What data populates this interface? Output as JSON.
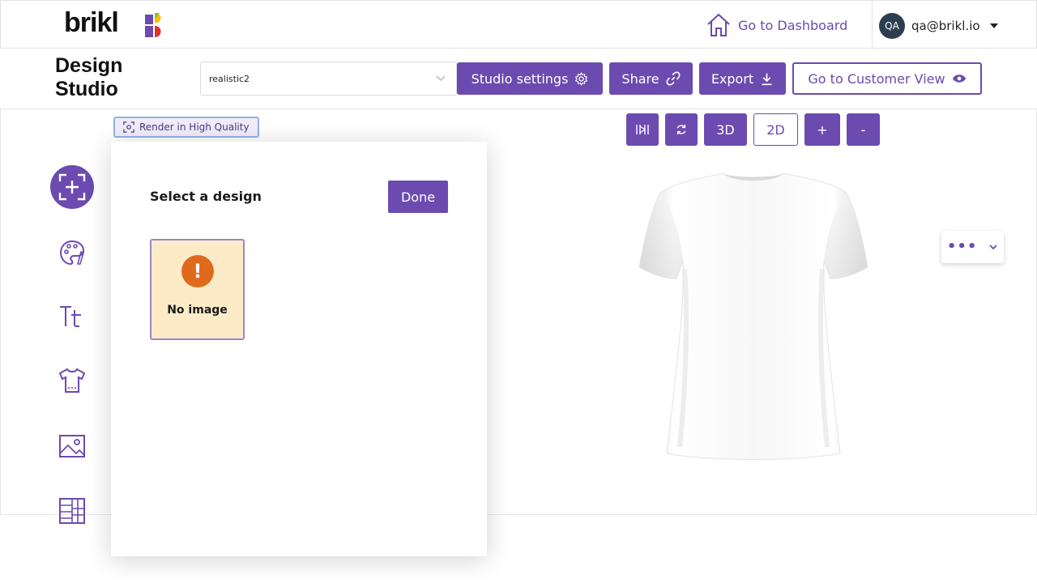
{
  "header": {
    "logo_text": "brikl",
    "dashboard_label": "Go to Dashboard",
    "user_initials": "QA",
    "user_email": "qa@brikl.io"
  },
  "toolbar": {
    "title": "Design Studio",
    "product_select_value": "realistic2",
    "studio_settings_label": "Studio settings",
    "share_label": "Share",
    "export_label": "Export",
    "customer_view_label": "Go to Customer View"
  },
  "render": {
    "hq_label": "Render in High Quality"
  },
  "sidebar": {
    "items": [
      "add-design",
      "colors",
      "text",
      "product",
      "image",
      "pattern"
    ]
  },
  "design_panel": {
    "title": "Select a design",
    "done_label": "Done",
    "card_label": "No image"
  },
  "viewer": {
    "mode_3d": "3D",
    "mode_2d": "2D",
    "zoom_in": "+",
    "zoom_out": "-",
    "more": "•••"
  },
  "colors": {
    "accent": "#6b4bb0",
    "warning": "#e06a1c",
    "card_bg": "#fdebc8"
  }
}
